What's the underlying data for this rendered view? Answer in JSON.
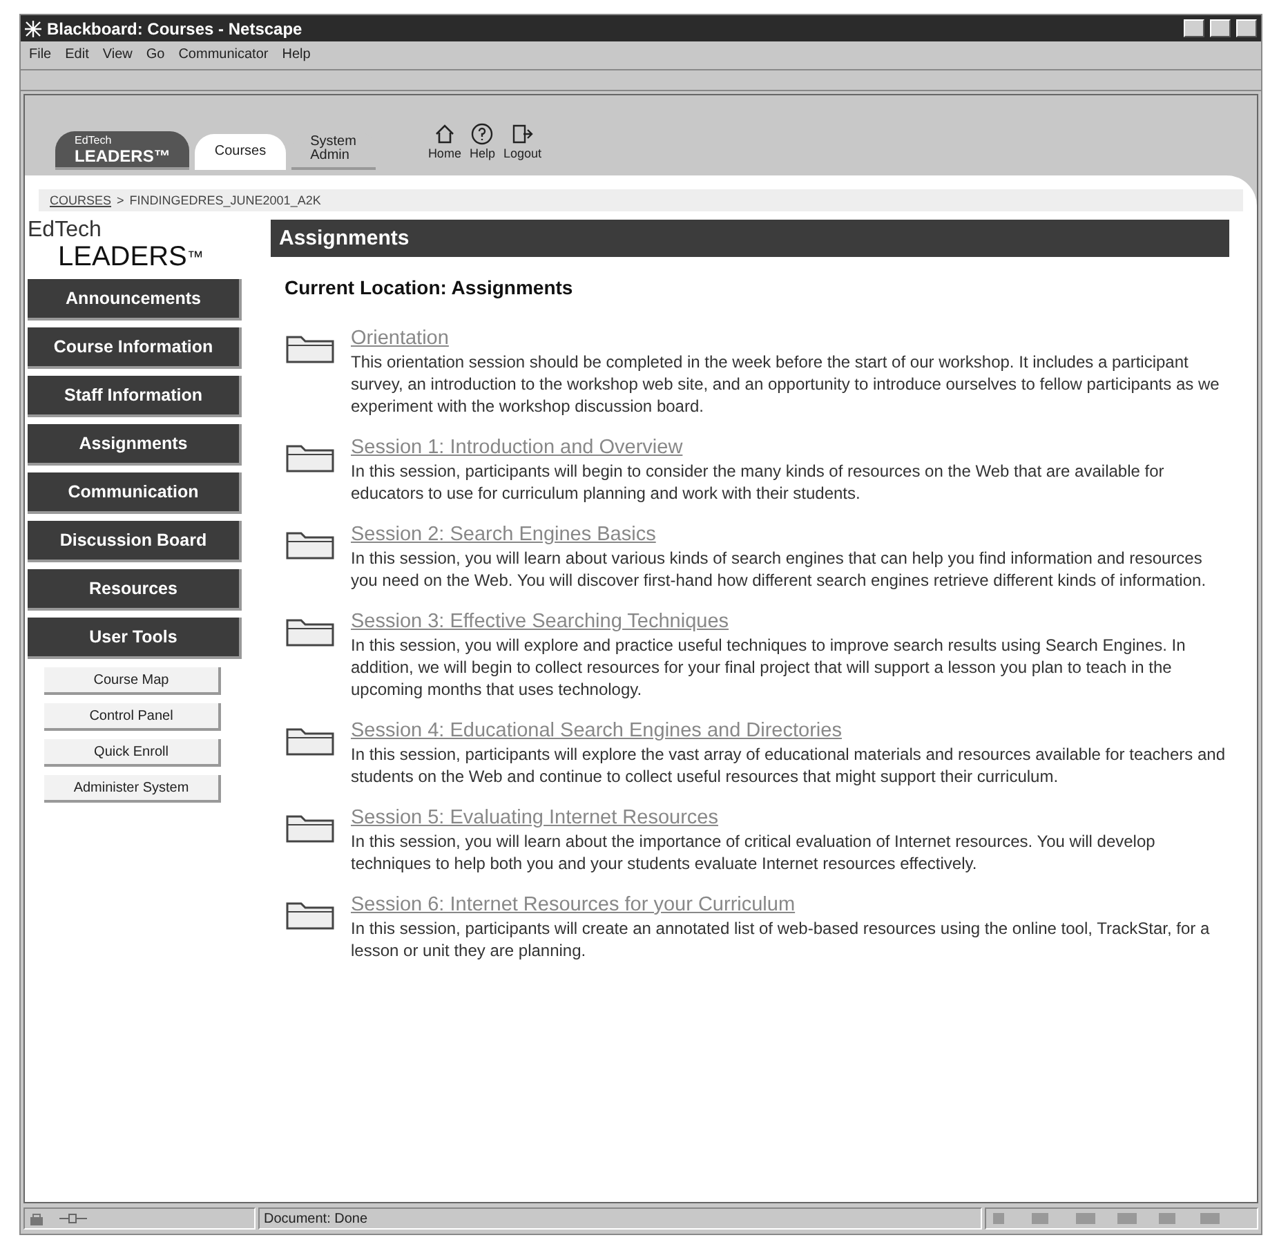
{
  "window": {
    "title": "Blackboard: Courses - Netscape"
  },
  "menu": [
    "File",
    "Edit",
    "View",
    "Go",
    "Communicator",
    "Help"
  ],
  "tabs": [
    {
      "label": "EdTech",
      "sublabel": "LEADERS™",
      "kind": "logo",
      "selected": false
    },
    {
      "label": "Courses",
      "kind": "text",
      "selected": true
    },
    {
      "label": "System",
      "sublabel": "Admin",
      "kind": "text",
      "selected": false
    }
  ],
  "toolbar": [
    {
      "label": "Home",
      "kind": "home"
    },
    {
      "label": "Help",
      "kind": "help"
    },
    {
      "label": "Logout",
      "kind": "logout"
    }
  ],
  "breadcrumb": {
    "link": "COURSES",
    "separator": ">",
    "current": "FINDINGEDRES_JUNE2001_A2K"
  },
  "logo": {
    "top": "EdTech",
    "bottom": "LEADERS",
    "mark": "™"
  },
  "nav": [
    "Announcements",
    "Course Information",
    "Staff Information",
    "Assignments",
    "Communication",
    "Discussion Board",
    "Resources",
    "User Tools"
  ],
  "tools": [
    "Course Map",
    "Control Panel",
    "Quick Enroll",
    "Administer System"
  ],
  "heading": "Assignments",
  "location": "Current Location: Assignments",
  "items": [
    {
      "title": "Orientation",
      "text": "This orientation session should be completed in the week before the start of our workshop. It includes a participant survey, an introduction to the workshop web site, and an opportunity to introduce ourselves to fellow participants as we experiment with the workshop discussion board."
    },
    {
      "title": "Session 1: Introduction and Overview",
      "text": "In this session, participants will begin to consider the many kinds of resources on the Web that are available for educators to use for curriculum planning and work with their students."
    },
    {
      "title": "Session 2: Search Engines Basics",
      "text": "In this session, you will learn about various kinds of search engines that can help you find information and resources you need on the Web. You will discover first-hand how different search engines retrieve different kinds of information."
    },
    {
      "title": "Session 3: Effective Searching Techniques",
      "text": "In this session, you will explore and practice useful techniques to improve search results using Search Engines. In addition, we will begin to collect resources for your final project that will support a lesson you plan to teach in the upcoming months that uses technology."
    },
    {
      "title": "Session 4: Educational Search Engines and Directories",
      "text": "In this session, participants will explore the vast array of educational materials and resources available for teachers and students on the Web and continue to collect useful resources that might support their curriculum."
    },
    {
      "title": "Session 5: Evaluating Internet Resources",
      "text": "In this session, you will learn about the importance of critical evaluation of Internet resources. You will develop techniques to help both you and your students evaluate Internet resources effectively."
    },
    {
      "title": "Session 6: Internet Resources for your Curriculum",
      "text": "In this session, participants will create an annotated list of web-based resources using the online tool, TrackStar, for a lesson or unit they are planning."
    }
  ],
  "status_bar": {
    "text": "Document: Done"
  }
}
